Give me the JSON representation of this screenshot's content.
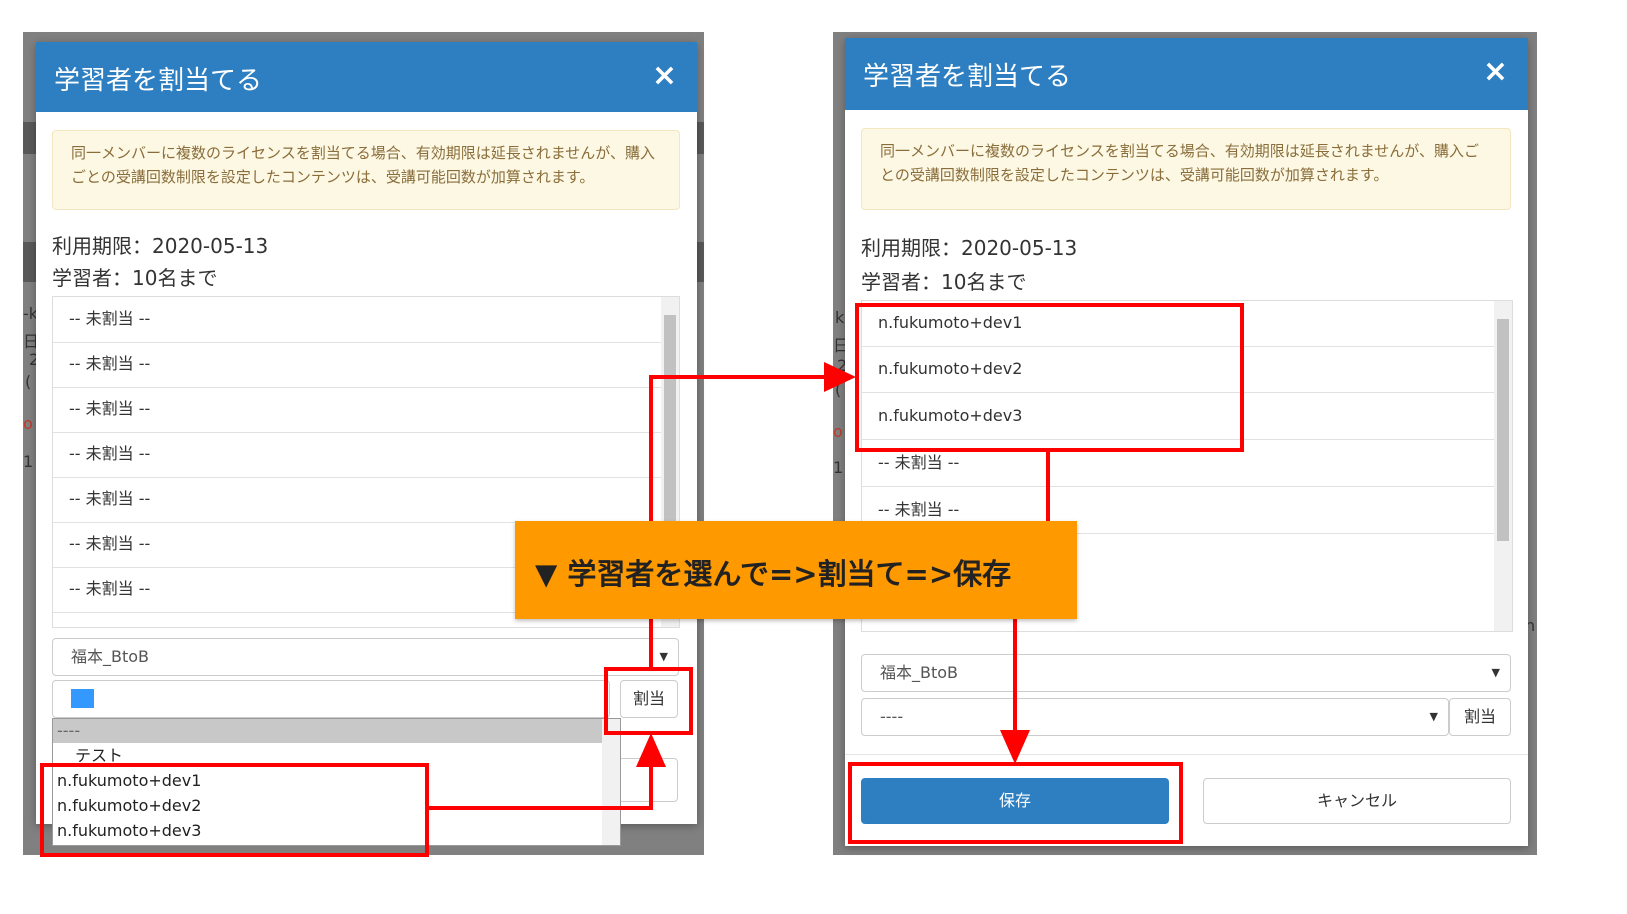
{
  "left": {
    "title": "学習者を割当てる",
    "close_icon": "×",
    "notice": "同一メンバーに複数のライセンスを割当てる場合、有効期限は延長されませんが、購入ごとの受講回数制限を設定したコンテンツは、受講可能回数が加算されます。",
    "expiry": "利用期限：2020-05-13",
    "learners": "学習者：10名まで",
    "rows": [
      "-- 未割当 --",
      "-- 未割当 --",
      "-- 未割当 --",
      "-- 未割当 --",
      "-- 未割当 --",
      "-- 未割当 --",
      "-- 未割当 --"
    ],
    "group_select": "福本_BtoB",
    "user_select": "----",
    "assign_button": "割当",
    "dropdown_options": [
      "----",
      "テスト",
      "n.fukumoto+dev1",
      "n.fukumoto+dev2",
      "n.fukumoto+dev3"
    ]
  },
  "right": {
    "title": "学習者を割当てる",
    "close_icon": "×",
    "notice": "同一メンバーに複数のライセンスを割当てる場合、有効期限は延長されませんが、購入ごとの受講回数制限を設定したコンテンツは、受講可能回数が加算されます。",
    "expiry": "利用期限：2020-05-13",
    "learners": "学習者：10名まで",
    "rows": [
      "n.fukumoto+dev1",
      "n.fukumoto+dev2",
      "n.fukumoto+dev3",
      "-- 未割当 --",
      "-- 未割当 --"
    ],
    "group_select": "福本_BtoB",
    "user_select": "----",
    "assign_button": "割当",
    "save_button": "保存",
    "cancel_button": "キャンセル"
  },
  "banner": "▼ 学習者を選んで=>割当て=>保存",
  "background_fragments": {
    "left": [
      "-k",
      "日",
      "2",
      "(",
      "o",
      "1"
    ],
    "right": [
      "k",
      "日",
      "2",
      "(",
      "o",
      "1",
      "n"
    ]
  },
  "colors": {
    "header_blue": "#2e7fc1",
    "annotation_red": "#ff0000",
    "banner_orange": "#ff9900",
    "notice_bg": "#fcf8e3"
  }
}
